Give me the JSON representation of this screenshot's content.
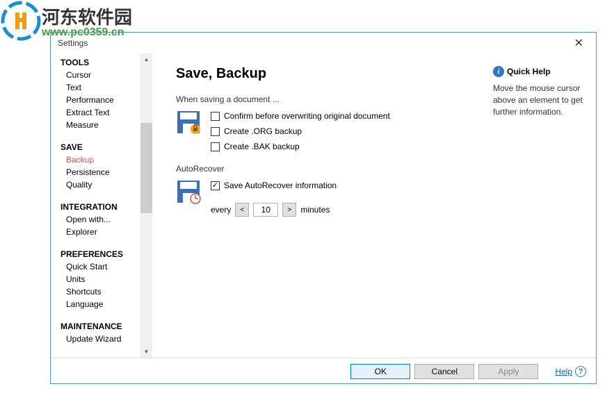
{
  "watermark": {
    "text": "河东软件园",
    "url": "www.pc0359.cn"
  },
  "dialog": {
    "title": "Settings"
  },
  "sidebar": {
    "sections": [
      {
        "heading": "TOOLS",
        "items": [
          "Cursor",
          "Text",
          "Performance",
          "Extract Text",
          "Measure"
        ]
      },
      {
        "heading": "SAVE",
        "items": [
          "Backup",
          "Persistence",
          "Quality"
        ]
      },
      {
        "heading": "INTEGRATION",
        "items": [
          "Open with...",
          "Explorer"
        ]
      },
      {
        "heading": "PREFERENCES",
        "items": [
          "Quick Start",
          "Units",
          "Shortcuts",
          "Language"
        ]
      },
      {
        "heading": "MAINTENANCE",
        "items": [
          "Update Wizard"
        ]
      }
    ],
    "active": "Backup"
  },
  "main": {
    "title": "Save, Backup",
    "saving": {
      "label": "When saving a document ...",
      "confirm_overwrite": "Confirm before overwriting original document",
      "create_org": "Create .ORG backup",
      "create_bak": "Create .BAK backup"
    },
    "autorecover": {
      "label": "AutoRecover",
      "save_info": "Save AutoRecover information",
      "every": "every",
      "value": "10",
      "minutes": "minutes"
    }
  },
  "help_panel": {
    "title": "Quick Help",
    "text": "Move the mouse cursor above an element to get further information."
  },
  "buttons": {
    "ok": "OK",
    "cancel": "Cancel",
    "apply": "Apply",
    "help": "Help"
  }
}
